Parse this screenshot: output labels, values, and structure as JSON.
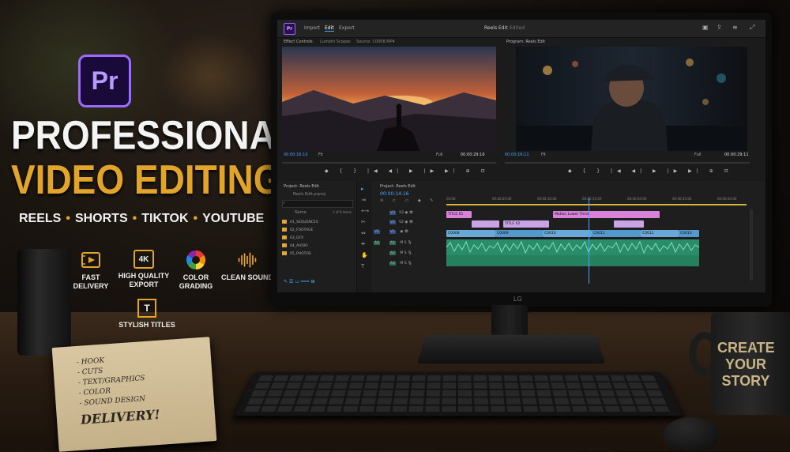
{
  "branding": {
    "app_logo": "Pr",
    "title_line1": "PROFESSIONAL",
    "title_line2": "VIDEO EDITING",
    "platforms": [
      "REELS",
      "SHORTS",
      "TIKTOK",
      "YOUTUBE"
    ],
    "accent_color": "#e2a52a",
    "logo_color": "#9b6bff"
  },
  "features": [
    {
      "icon": "film-fast-icon",
      "label": "FAST\nDELIVERY"
    },
    {
      "icon": "4k-icon",
      "icon_text": "4K",
      "label": "HIGH QUALITY\nEXPORT"
    },
    {
      "icon": "color-wheel-icon",
      "label": "COLOR\nGRADING"
    },
    {
      "icon": "waveform-icon",
      "label": "CLEAN SOUND"
    },
    {
      "icon": "text-tool-icon",
      "icon_text": "T",
      "label": "STYLISH TITLES"
    }
  ],
  "app": {
    "logo": "Pr",
    "tabs": [
      "Import",
      "Edit",
      "Export"
    ],
    "active_tab": "Edit",
    "doc_title": "Reels Edit",
    "doc_status": "Edited",
    "source_panel": {
      "tabs": [
        "Effect Controls",
        "Lumetri Scopes",
        "Source: C0008.MP4"
      ],
      "timecode_left": "00:00:16:10",
      "fit": "Fit",
      "full": "Full",
      "timecode_right": "00:00:29:16"
    },
    "program_panel": {
      "tab": "Program: Reels Edit",
      "timecode_left": "00:00:16:11",
      "fit": "Fit",
      "full": "Full",
      "timecode_right": "00:00:29:11"
    },
    "project_panel": {
      "tab": "Project: Reels Edit",
      "file": "Reels Edit.prproj",
      "col_name": "Name",
      "col_count": "1 of 9 items",
      "folders": [
        "01_SEQUENCES",
        "02_FOOTAGE",
        "03_GFX",
        "04_AUDIO",
        "05_PHOTOS"
      ]
    },
    "timeline": {
      "tab": "Project: Reels Edit",
      "timecode": "00:00:14:16",
      "ruler": [
        "00:00",
        "00:00:05:00",
        "00:00:10:00",
        "00:00:15:00",
        "00:00:20:00",
        "00:00:25:00",
        "00:00:30:00"
      ],
      "tracks": [
        "V3",
        "V2",
        "V1",
        "A1",
        "A2",
        "A3"
      ],
      "clips": {
        "title_1": "TITLE 01",
        "title_2": "TITLE 02",
        "title_3": "Motion Lower Third",
        "v1": [
          "C0008",
          "C0009",
          "C0010",
          "C0011",
          "C0012",
          "C0013"
        ]
      }
    }
  },
  "notebook": {
    "lines": [
      "- HOOK",
      "- CUTS",
      "- TEXT/GRAPHICS",
      "- COLOR",
      "- SOUND DESIGN"
    ],
    "final": "DELIVERY!"
  },
  "mug": {
    "line1": "CREATE",
    "line2": "YOUR",
    "line3": "STORY"
  },
  "monitor_brand": "LG"
}
